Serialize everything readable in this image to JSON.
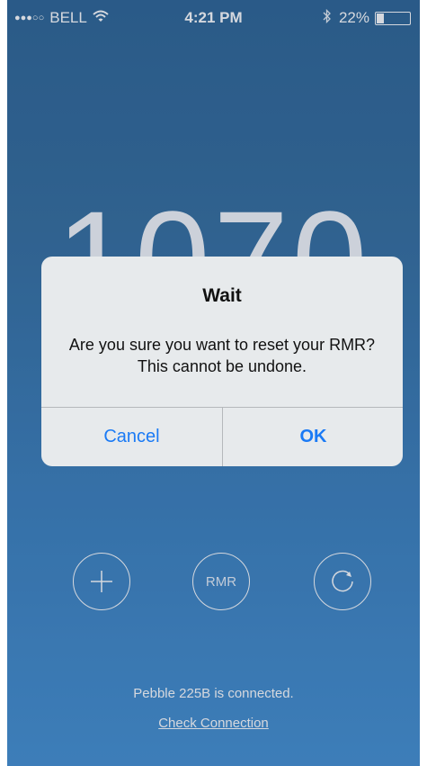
{
  "status_bar": {
    "signal": "●●●○○",
    "carrier": "BELL",
    "wifi_icon": "wifi-icon",
    "time": "4:21 PM",
    "bluetooth_icon": "bluetooth-icon",
    "battery_percent": "22%",
    "battery_level": 0.22
  },
  "main": {
    "big_number": "1070",
    "buttons": [
      {
        "name": "add-button",
        "icon": "plus-icon"
      },
      {
        "name": "rmr-button",
        "label": "RMR"
      },
      {
        "name": "reset-button",
        "icon": "refresh-icon"
      }
    ],
    "connection_status": "Pebble 225B is connected.",
    "check_connection_label": "Check Connection"
  },
  "alert": {
    "title": "Wait",
    "message": "Are you sure you want to reset your RMR? This cannot be undone.",
    "cancel_label": "Cancel",
    "ok_label": "OK"
  },
  "colors": {
    "accent": "#1a7af5",
    "background_top": "#2f6696",
    "background_bottom": "#4691d2",
    "alert_background": "#e7eaec"
  }
}
